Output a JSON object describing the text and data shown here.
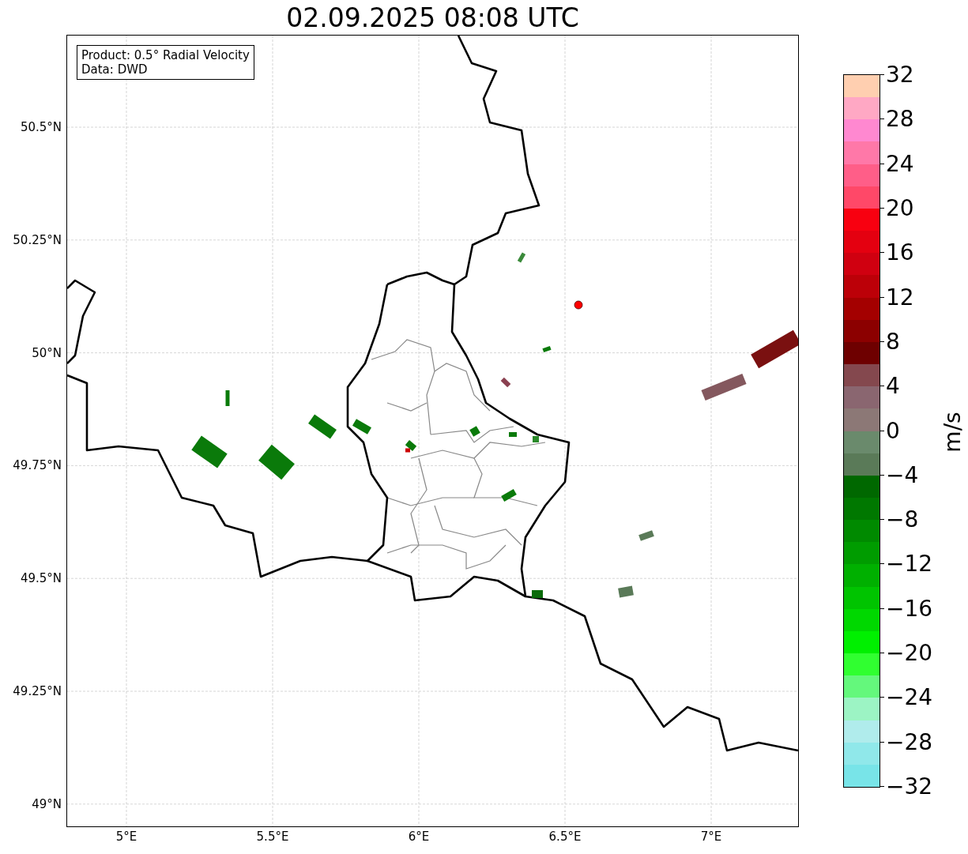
{
  "title": "02.09.2025 08:08 UTC",
  "info_box": {
    "lines": [
      "Product: 0.5° Radial Velocity",
      "Data: DWD"
    ]
  },
  "map": {
    "lon_labels": [
      "5°E",
      "5.5°E",
      "6°E",
      "6.5°E",
      "7°E"
    ],
    "lat_labels": [
      "50.5°N",
      "50.25°N",
      "50°N",
      "49.75°N",
      "49.5°N",
      "49.25°N",
      "49°N"
    ]
  },
  "colorbar": {
    "label": "m/s",
    "ticks": [
      "32",
      "28",
      "24",
      "20",
      "16",
      "12",
      "8",
      "4",
      "0",
      "−4",
      "−8",
      "−12",
      "−16",
      "−20",
      "−24",
      "−28",
      "−32"
    ],
    "bins": [
      {
        "color": "#ffcfb0"
      },
      {
        "color": "#ffa8c4"
      },
      {
        "color": "#ff88d0"
      },
      {
        "color": "#ff78a8"
      },
      {
        "color": "#ff5e88"
      },
      {
        "color": "#ff4868"
      },
      {
        "color": "#f80010"
      },
      {
        "color": "#e40010"
      },
      {
        "color": "#d00010"
      },
      {
        "color": "#bc0008"
      },
      {
        "color": "#a40000"
      },
      {
        "color": "#8c0000"
      },
      {
        "color": "#6e0000"
      },
      {
        "color": "#84484e"
      },
      {
        "color": "#8a6670"
      },
      {
        "color": "#8c7876"
      },
      {
        "color": "#6a8a6c"
      },
      {
        "color": "#5a7a58"
      },
      {
        "color": "#006800"
      },
      {
        "color": "#007800"
      },
      {
        "color": "#008a00"
      },
      {
        "color": "#009c00"
      },
      {
        "color": "#00b000"
      },
      {
        "color": "#00c400"
      },
      {
        "color": "#00d800"
      },
      {
        "color": "#00f000"
      },
      {
        "color": "#30ff30"
      },
      {
        "color": "#64f87c"
      },
      {
        "color": "#9cf4c4"
      },
      {
        "color": "#b0ecec"
      },
      {
        "color": "#90e8ea"
      },
      {
        "color": "#78e4e8"
      }
    ]
  }
}
